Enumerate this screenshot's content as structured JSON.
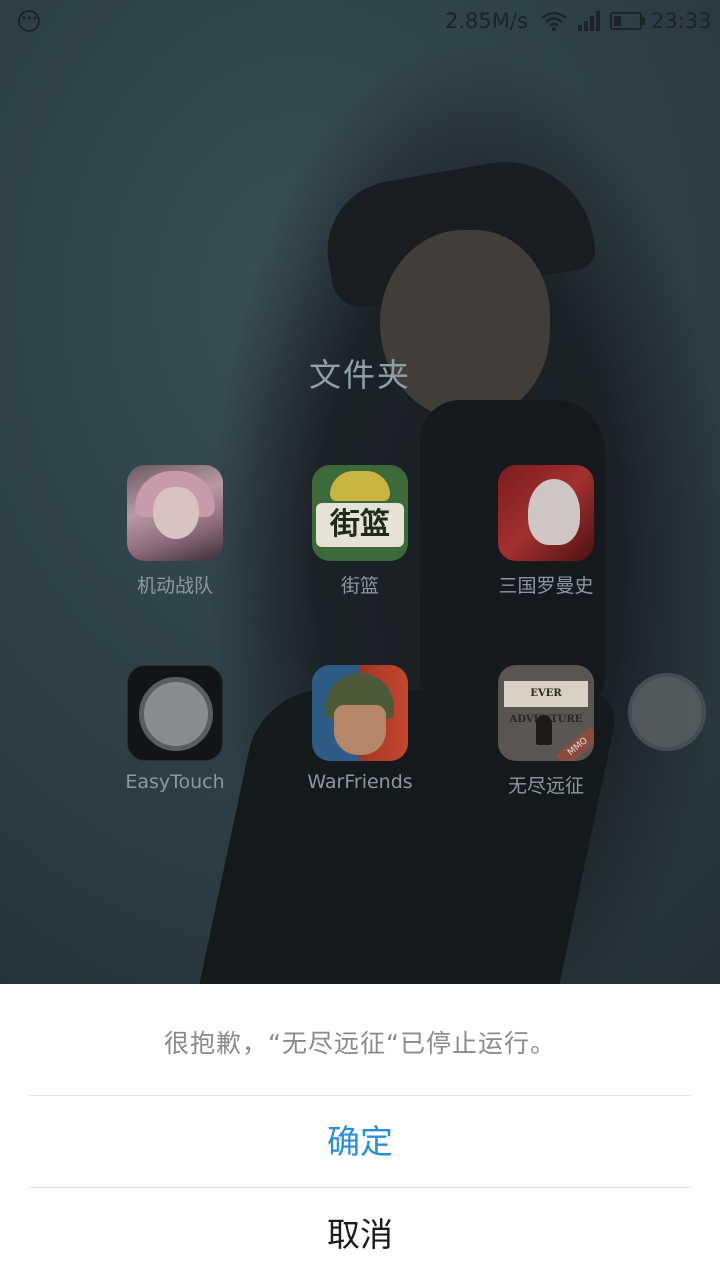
{
  "status_bar": {
    "left_icon": "notification-dots-icon",
    "network_speed": "2.85M/s",
    "icons": [
      "wifi-icon",
      "signal-icon",
      "battery-icon"
    ],
    "time": "23:33"
  },
  "folder": {
    "title": "文件夹",
    "apps": [
      {
        "label": "机动战队",
        "icon": "anime-girl-game-icon"
      },
      {
        "label": "街篮",
        "icon": "street-basketball-game-icon",
        "icon_text": "街篮"
      },
      {
        "label": "三国罗曼史",
        "icon": "three-kingdoms-game-icon"
      },
      {
        "label": "EasyTouch",
        "icon": "easytouch-icon"
      },
      {
        "label": "WarFriends",
        "icon": "warfriends-game-icon"
      },
      {
        "label": "无尽远征",
        "icon": "ever-adventure-game-icon",
        "icon_text": "EVER ADVENTURE",
        "icon_tag": "MMO"
      }
    ]
  },
  "floating_button": {
    "icon": "floating-assist-ball-icon"
  },
  "dialog": {
    "message": "很抱歉，“无尽远征“已停止运行。",
    "ok_label": "确定",
    "cancel_label": "取消",
    "ok_color": "#2a8fd8"
  }
}
